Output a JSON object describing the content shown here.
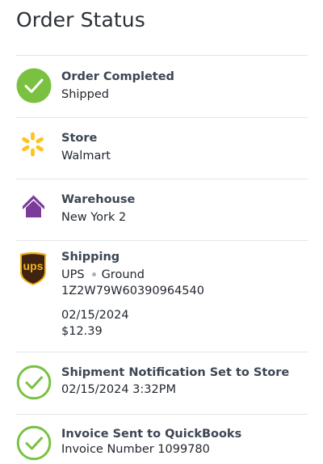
{
  "page_title": "Order Status",
  "icons": {
    "order_completed": "check-circle-filled-icon",
    "store": "walmart-spark-icon",
    "warehouse": "house-icon",
    "shipping": "ups-logo-icon",
    "notification": "check-circle-outline-icon",
    "invoice": "check-circle-outline-icon"
  },
  "colors": {
    "success_green": "#7ac142",
    "walmart_yellow": "#ffc220",
    "warehouse_purple": "#7b3b9b",
    "ups_brown": "#3d2310",
    "ups_gold": "#f5b31a"
  },
  "order_completed": {
    "label": "Order Completed",
    "value": "Shipped"
  },
  "store": {
    "label": "Store",
    "value": "Walmart"
  },
  "warehouse": {
    "label": "Warehouse",
    "value": "New York 2"
  },
  "shipping": {
    "label": "Shipping",
    "carrier": "UPS",
    "service": "Ground",
    "tracking": "1Z2W79W60390964540",
    "date": "02/15/2024",
    "cost": "$12.39",
    "logo_text": "ups"
  },
  "notification": {
    "label": "Shipment Notification Set to Store",
    "value": "02/15/2024 3:32PM"
  },
  "invoice": {
    "label": "Invoice Sent to QuickBooks",
    "value": "Invoice Number 1099780"
  }
}
